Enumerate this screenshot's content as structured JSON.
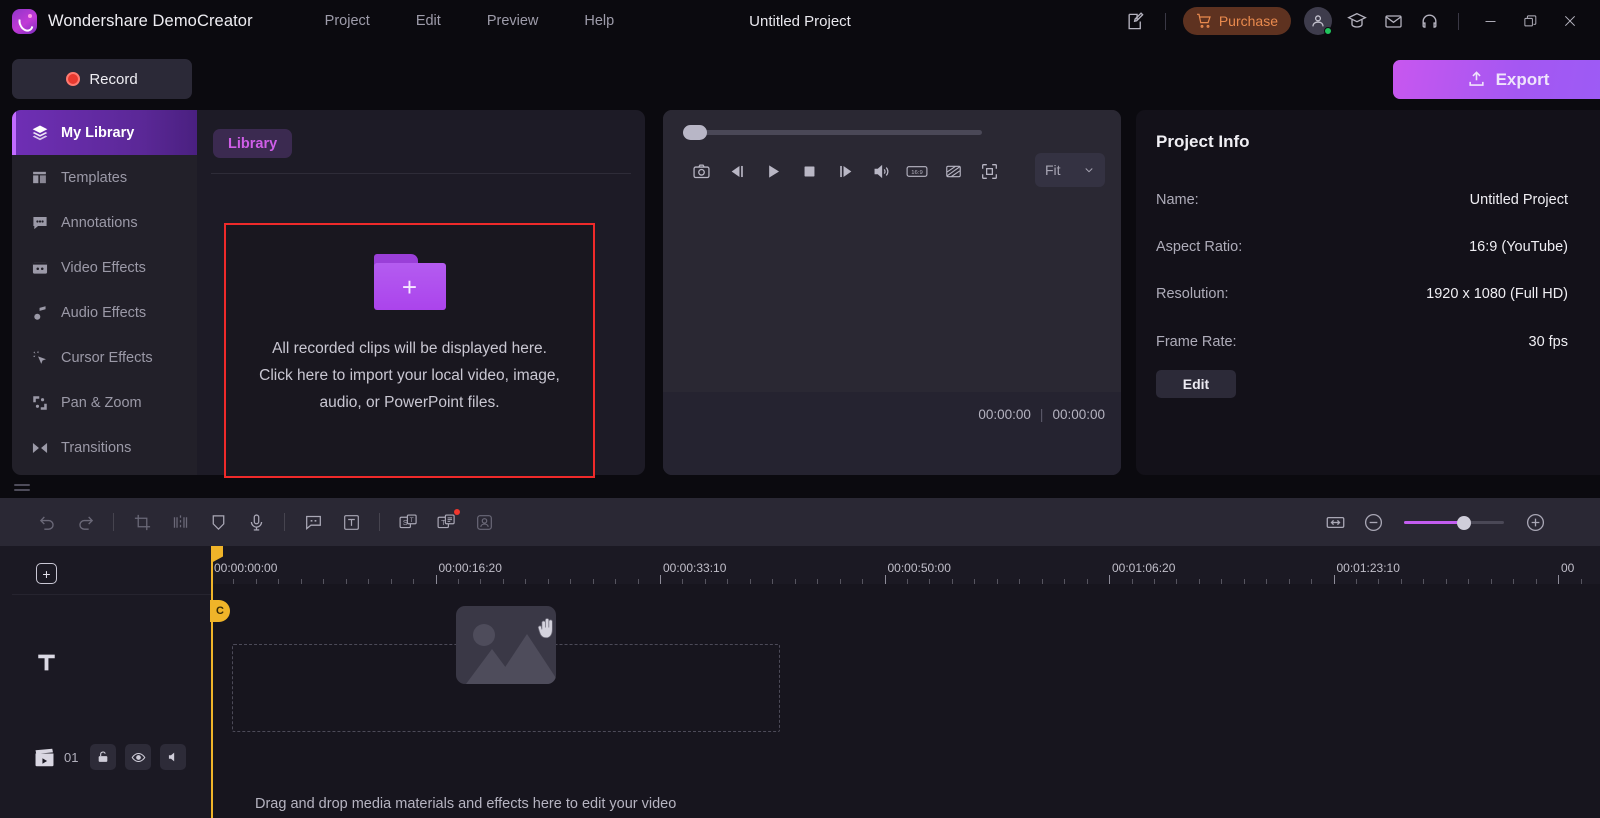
{
  "titlebar": {
    "brand": "Wondershare DemoCreator",
    "menus": [
      "Project",
      "Edit",
      "Preview",
      "Help"
    ],
    "project_title": "Untitled Project",
    "feedback_icon": "feedback-icon",
    "purchase_label": "Purchase",
    "cart_icon": "cart-icon",
    "account_icon": "account-icon",
    "tutorial_icon": "graduation-cap-icon",
    "mail_icon": "mail-icon",
    "support_icon": "headset-icon",
    "minimize_icon": "minimize-icon",
    "restore_icon": "restore-icon",
    "close_icon": "close-icon"
  },
  "actions": {
    "record_label": "Record",
    "record_icon": "record-dot-icon",
    "export_label": "Export",
    "export_icon": "export-icon"
  },
  "sidebar": {
    "items": [
      {
        "label": "My Library",
        "icon": "layers-icon",
        "active": true
      },
      {
        "label": "Templates",
        "icon": "templates-icon",
        "active": false
      },
      {
        "label": "Annotations",
        "icon": "annotation-icon",
        "active": false
      },
      {
        "label": "Video Effects",
        "icon": "video-effects-icon",
        "active": false
      },
      {
        "label": "Audio Effects",
        "icon": "audio-note-icon",
        "active": false
      },
      {
        "label": "Cursor Effects",
        "icon": "cursor-click-icon",
        "active": false
      },
      {
        "label": "Pan & Zoom",
        "icon": "pan-zoom-icon",
        "active": false
      },
      {
        "label": "Transitions",
        "icon": "transitions-icon",
        "active": false
      }
    ]
  },
  "library": {
    "tab_label": "Library",
    "dropzone": {
      "folder_icon": "folder-plus-icon",
      "line1": "All recorded clips will be displayed",
      "line2": "here.",
      "line3": "Click here to import your local video,",
      "line4": "image, audio, or PowerPoint files."
    },
    "highlight_color": "#ef2a2a"
  },
  "preview": {
    "current_time": "00:00:00",
    "total_time": "00:00:00",
    "time_separator": "|",
    "controls": [
      {
        "name": "snapshot-icon"
      },
      {
        "name": "previous-frame-icon"
      },
      {
        "name": "play-icon"
      },
      {
        "name": "stop-icon"
      },
      {
        "name": "next-frame-icon"
      },
      {
        "name": "volume-icon"
      },
      {
        "name": "aspect-ratio-16-9-icon"
      },
      {
        "name": "no-signal-icon"
      },
      {
        "name": "fullscreen-icon"
      }
    ],
    "fit_label": "Fit",
    "fit_caret": "chevron-down-icon"
  },
  "project_info": {
    "title": "Project Info",
    "rows": [
      {
        "key": "Name:",
        "value": "Untitled Project"
      },
      {
        "key": "Aspect Ratio:",
        "value": "16:9 (YouTube)"
      },
      {
        "key": "Resolution:",
        "value": "1920 x 1080 (Full HD)"
      },
      {
        "key": "Frame Rate:",
        "value": "30 fps"
      }
    ],
    "edit_label": "Edit"
  },
  "timeline_toolbar": {
    "tools": [
      {
        "name": "undo-icon",
        "dim": true
      },
      {
        "name": "redo-icon",
        "dim": true
      },
      {
        "name": "crop-icon",
        "dim": true
      },
      {
        "name": "split-icon",
        "dim": true
      },
      {
        "name": "marker-icon",
        "dim": false
      },
      {
        "name": "microphone-icon",
        "dim": false
      },
      {
        "name": "caption-icon",
        "dim": false
      },
      {
        "name": "text-icon",
        "dim": false
      },
      {
        "name": "speech-to-text-icon",
        "dim": false
      },
      {
        "name": "text-to-speech-icon",
        "dim": false,
        "badge": true
      },
      {
        "name": "ai-avatar-icon",
        "dim": true
      }
    ],
    "zoom": {
      "fit_icon": "fit-to-width-icon",
      "minus_icon": "zoom-out-icon",
      "plus_icon": "zoom-in-icon",
      "level_percent": 60
    }
  },
  "timeline": {
    "add_track_icon": "add-track-icon",
    "text_track_icon": "text-track-icon",
    "track_number": "01",
    "lock_icon": "unlock-icon",
    "eye_icon": "eye-visible-icon",
    "mute_icon": "speaker-mute-icon",
    "ruler_labels": [
      "00:00:00:00",
      "00:00:16:20",
      "00:00:33:10",
      "00:00:50:00",
      "00:01:06:20",
      "00:01:23:10",
      "00"
    ],
    "playhead_badge": "C",
    "drop_hint": "Drag and drop media materials and effects here to edit your video",
    "placeholder_icon": "image-placeholder-icon",
    "cursor_icon": "grab-hand-icon",
    "playhead_color": "#f0b429"
  }
}
